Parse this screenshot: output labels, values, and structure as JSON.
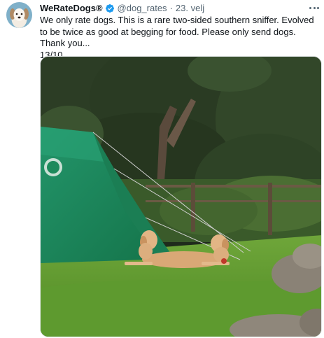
{
  "tweet": {
    "display_name": "WeRateDogs®",
    "handle": "@dog_rates",
    "separator": "·",
    "timestamp": "23. velj",
    "text": "We only rate dogs. This is a rare two-sided southern sniffer. Evolved to be twice as good at begging for food. Please only send dogs. Thank you...\n13/10",
    "icons": {
      "verified": "verified-badge-icon",
      "more": "more-options-icon"
    }
  },
  "colors": {
    "verified_blue": "#1d9bf0",
    "secondary_text": "#536471",
    "primary_text": "#0f1419",
    "tent_green": "#1e8a5c",
    "grass_green": "#5f9a2e"
  }
}
